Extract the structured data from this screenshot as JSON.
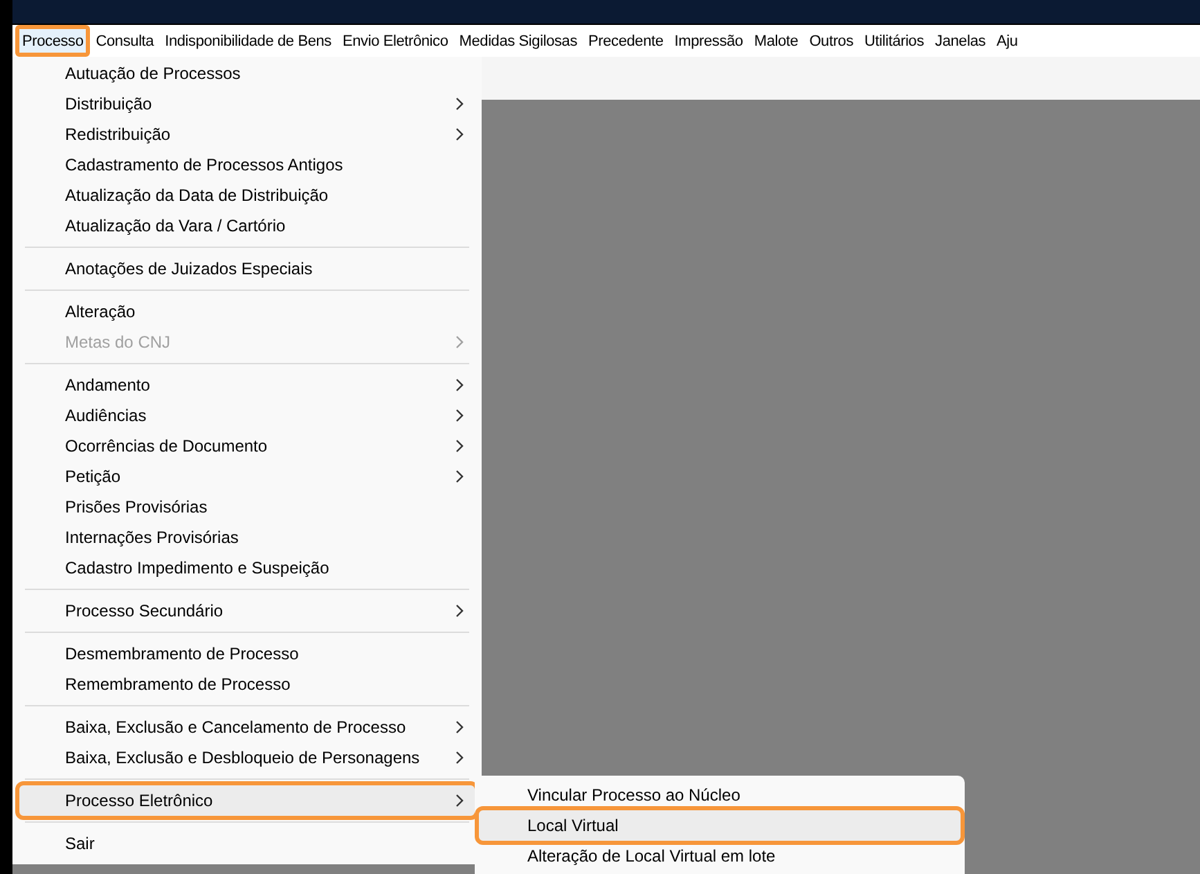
{
  "menu_bar": [
    {
      "label": "Processo",
      "selected": true,
      "highlighted": true
    },
    {
      "label": "Consulta",
      "selected": false,
      "highlighted": false
    },
    {
      "label": "Indisponibilidade de Bens",
      "selected": false,
      "highlighted": false
    },
    {
      "label": "Envio Eletrônico",
      "selected": false,
      "highlighted": false
    },
    {
      "label": "Medidas Sigilosas",
      "selected": false,
      "highlighted": false
    },
    {
      "label": "Precedente",
      "selected": false,
      "highlighted": false
    },
    {
      "label": "Impressão",
      "selected": false,
      "highlighted": false
    },
    {
      "label": "Malote",
      "selected": false,
      "highlighted": false
    },
    {
      "label": "Outros",
      "selected": false,
      "highlighted": false
    },
    {
      "label": "Utilitários",
      "selected": false,
      "highlighted": false
    },
    {
      "label": "Janelas",
      "selected": false,
      "highlighted": false
    },
    {
      "label": "Aju",
      "selected": false,
      "highlighted": false
    }
  ],
  "dropdown": [
    {
      "kind": "item",
      "label": "Autuação de Processos",
      "submenu": false,
      "disabled": false,
      "selected": false
    },
    {
      "kind": "item",
      "label": "Distribuição",
      "submenu": true,
      "disabled": false,
      "selected": false
    },
    {
      "kind": "item",
      "label": "Redistribuição",
      "submenu": true,
      "disabled": false,
      "selected": false
    },
    {
      "kind": "item",
      "label": "Cadastramento de Processos Antigos",
      "submenu": false,
      "disabled": false,
      "selected": false
    },
    {
      "kind": "item",
      "label": "Atualização da Data de Distribuição",
      "submenu": false,
      "disabled": false,
      "selected": false
    },
    {
      "kind": "item",
      "label": "Atualização da Vara / Cartório",
      "submenu": false,
      "disabled": false,
      "selected": false
    },
    {
      "kind": "separator"
    },
    {
      "kind": "item",
      "label": "Anotações de Juizados Especiais",
      "submenu": false,
      "disabled": false,
      "selected": false
    },
    {
      "kind": "separator"
    },
    {
      "kind": "item",
      "label": "Alteração",
      "submenu": false,
      "disabled": false,
      "selected": false
    },
    {
      "kind": "item",
      "label": "Metas do CNJ",
      "submenu": true,
      "disabled": true,
      "selected": false
    },
    {
      "kind": "separator"
    },
    {
      "kind": "item",
      "label": "Andamento",
      "submenu": true,
      "disabled": false,
      "selected": false
    },
    {
      "kind": "item",
      "label": "Audiências",
      "submenu": true,
      "disabled": false,
      "selected": false
    },
    {
      "kind": "item",
      "label": "Ocorrências de Documento",
      "submenu": true,
      "disabled": false,
      "selected": false
    },
    {
      "kind": "item",
      "label": "Petição",
      "submenu": true,
      "disabled": false,
      "selected": false
    },
    {
      "kind": "item",
      "label": "Prisões Provisórias",
      "submenu": false,
      "disabled": false,
      "selected": false
    },
    {
      "kind": "item",
      "label": "Internações Provisórias",
      "submenu": false,
      "disabled": false,
      "selected": false
    },
    {
      "kind": "item",
      "label": "Cadastro Impedimento e Suspeição",
      "submenu": false,
      "disabled": false,
      "selected": false
    },
    {
      "kind": "separator"
    },
    {
      "kind": "item",
      "label": "Processo Secundário",
      "submenu": true,
      "disabled": false,
      "selected": false
    },
    {
      "kind": "separator"
    },
    {
      "kind": "item",
      "label": "Desmembramento de Processo",
      "submenu": false,
      "disabled": false,
      "selected": false
    },
    {
      "kind": "item",
      "label": "Remembramento de Processo",
      "submenu": false,
      "disabled": false,
      "selected": false
    },
    {
      "kind": "separator"
    },
    {
      "kind": "item",
      "label": "Baixa, Exclusão e Cancelamento de Processo",
      "submenu": true,
      "disabled": false,
      "selected": false
    },
    {
      "kind": "item",
      "label": "Baixa, Exclusão e Desbloqueio de Personagens",
      "submenu": true,
      "disabled": false,
      "selected": false
    },
    {
      "kind": "separator"
    },
    {
      "kind": "item",
      "label": "Processo Eletrônico",
      "submenu": true,
      "disabled": false,
      "selected": true,
      "highlighted": true
    },
    {
      "kind": "separator"
    },
    {
      "kind": "item",
      "label": "Sair",
      "submenu": false,
      "disabled": false,
      "selected": false
    }
  ],
  "submenu": [
    {
      "label": "Vincular Processo ao Núcleo",
      "selected": false,
      "highlighted": false
    },
    {
      "label": "Local Virtual",
      "selected": true,
      "highlighted": true
    },
    {
      "label": "Alteração de Local Virtual em lote",
      "selected": false,
      "highlighted": false
    }
  ]
}
